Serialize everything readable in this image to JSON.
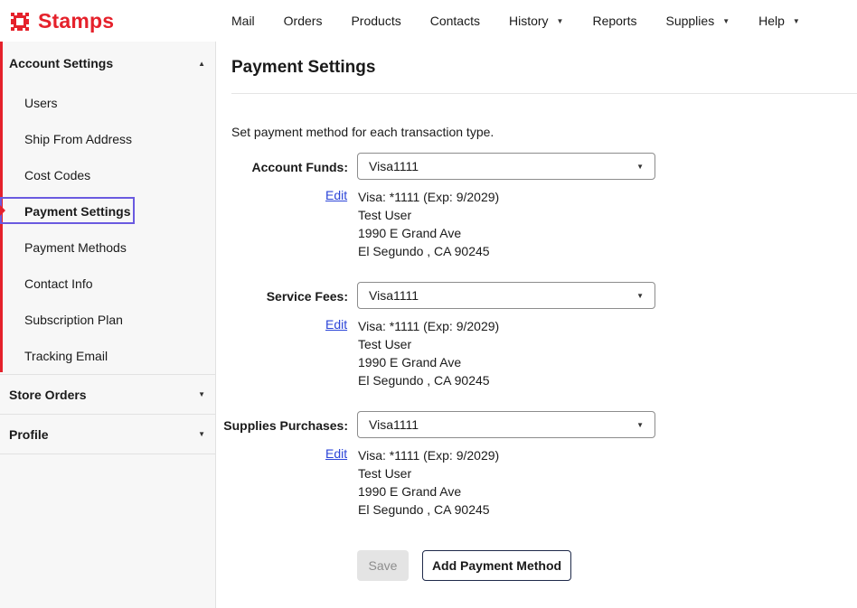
{
  "brand": {
    "name": "Stamps",
    "color": "#e5212b",
    "logo_icon": "stamp-logo-icon"
  },
  "nav": {
    "items": [
      {
        "label": "Mail",
        "has_dropdown": false
      },
      {
        "label": "Orders",
        "has_dropdown": false
      },
      {
        "label": "Products",
        "has_dropdown": false
      },
      {
        "label": "Contacts",
        "has_dropdown": false
      },
      {
        "label": "History",
        "has_dropdown": true
      },
      {
        "label": "Reports",
        "has_dropdown": false
      },
      {
        "label": "Supplies",
        "has_dropdown": true
      },
      {
        "label": "Help",
        "has_dropdown": true
      }
    ]
  },
  "sidebar": {
    "account_settings": {
      "label": "Account Settings",
      "expanded": true,
      "items": [
        {
          "label": "Users"
        },
        {
          "label": "Ship From Address"
        },
        {
          "label": "Cost Codes"
        },
        {
          "label": "Payment Settings",
          "selected": true
        },
        {
          "label": "Payment Methods"
        },
        {
          "label": "Contact Info"
        },
        {
          "label": "Subscription Plan"
        },
        {
          "label": "Tracking Email"
        }
      ]
    },
    "store_orders": {
      "label": "Store Orders",
      "expanded": false
    },
    "profile": {
      "label": "Profile",
      "expanded": false
    }
  },
  "main": {
    "title": "Payment Settings",
    "intro": "Set payment method for each transaction type.",
    "rows": [
      {
        "label": "Account Funds:",
        "selected": "Visa1111",
        "edit_label": "Edit",
        "card": "Visa: *1111 (Exp: 9/2029)",
        "name": "Test User",
        "street": "1990 E Grand Ave",
        "city": "El Segundo , CA 90245"
      },
      {
        "label": "Service Fees:",
        "selected": "Visa1111",
        "edit_label": "Edit",
        "card": "Visa: *1111 (Exp: 9/2029)",
        "name": "Test User",
        "street": "1990 E Grand Ave",
        "city": "El Segundo , CA 90245"
      },
      {
        "label": "Supplies Purchases:",
        "selected": "Visa1111",
        "edit_label": "Edit",
        "card": "Visa: *1111 (Exp: 9/2029)",
        "name": "Test User",
        "street": "1990 E Grand Ave",
        "city": "El Segundo , CA 90245"
      }
    ],
    "save_label": "Save",
    "add_label": "Add Payment Method"
  },
  "colors": {
    "accent_red": "#e5212b",
    "selection_outline": "#6a5ae0",
    "link": "#2b44d8"
  }
}
